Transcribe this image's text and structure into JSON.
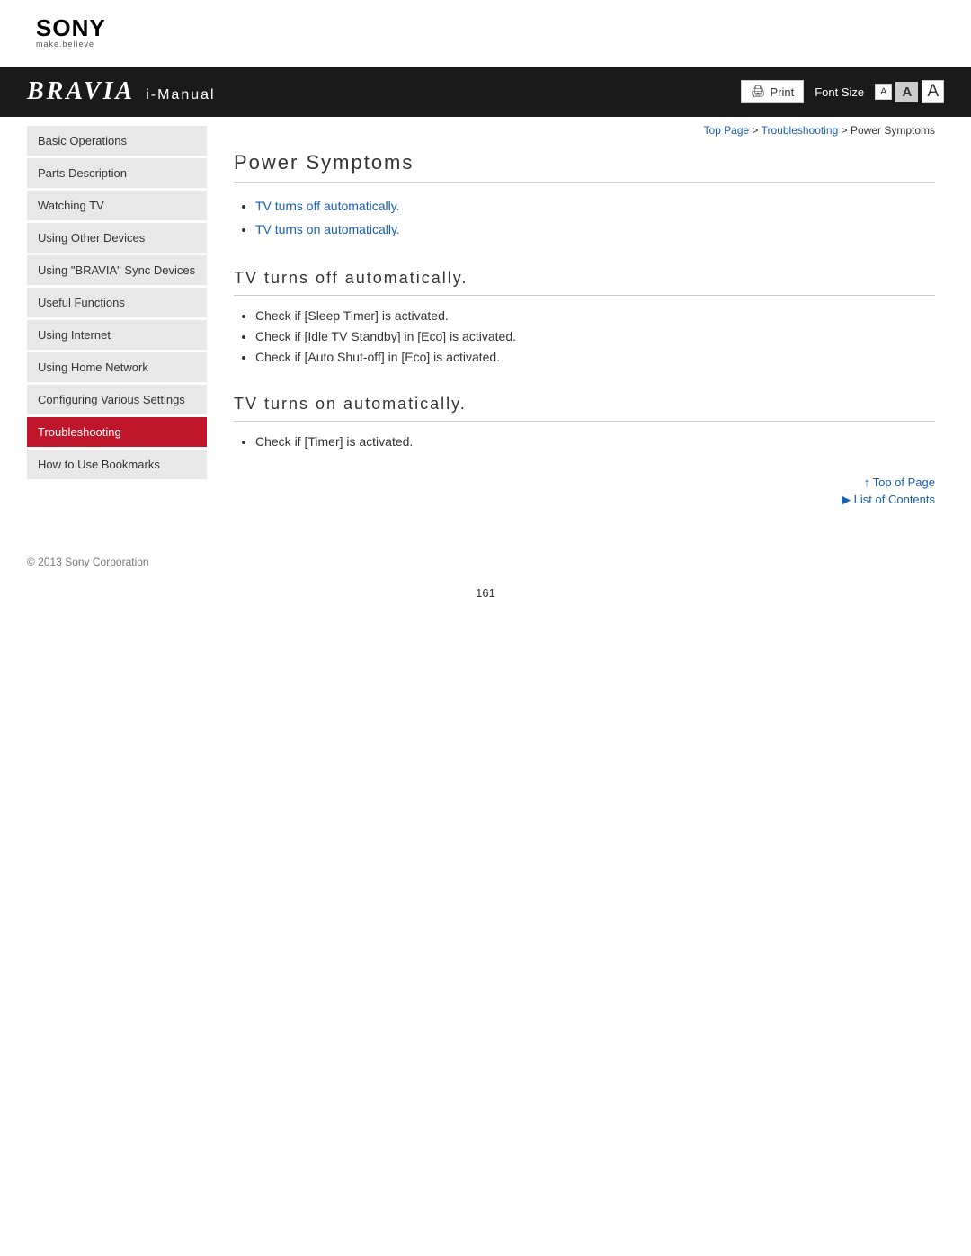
{
  "logo": {
    "brand": "SONY",
    "tagline": "make.believe"
  },
  "header": {
    "bravia": "BRAVIA",
    "imanual": "i-Manual",
    "print_label": "Print",
    "font_size_label": "Font Size",
    "font_small": "A",
    "font_medium": "A",
    "font_large": "A"
  },
  "breadcrumb": {
    "top_page": "Top Page",
    "separator1": " > ",
    "troubleshooting": "Troubleshooting",
    "separator2": " > ",
    "current": "Power Symptoms"
  },
  "sidebar": {
    "items": [
      {
        "id": "basic-operations",
        "label": "Basic Operations",
        "active": false
      },
      {
        "id": "parts-description",
        "label": "Parts Description",
        "active": false
      },
      {
        "id": "watching-tv",
        "label": "Watching TV",
        "active": false
      },
      {
        "id": "using-other-devices",
        "label": "Using Other Devices",
        "active": false
      },
      {
        "id": "using-bravia-sync",
        "label": "Using \"BRAVIA\" Sync Devices",
        "active": false
      },
      {
        "id": "useful-functions",
        "label": "Useful Functions",
        "active": false
      },
      {
        "id": "using-internet",
        "label": "Using Internet",
        "active": false
      },
      {
        "id": "using-home-network",
        "label": "Using Home Network",
        "active": false
      },
      {
        "id": "configuring-settings",
        "label": "Configuring Various Settings",
        "active": false
      },
      {
        "id": "troubleshooting",
        "label": "Troubleshooting",
        "active": true
      },
      {
        "id": "bookmarks",
        "label": "How to Use Bookmarks",
        "active": false
      }
    ]
  },
  "content": {
    "page_title": "Power Symptoms",
    "links": [
      {
        "label": "TV turns off automatically.",
        "href": "#off"
      },
      {
        "label": "TV turns on automatically.",
        "href": "#on"
      }
    ],
    "sections": [
      {
        "id": "off",
        "heading": "TV turns off automatically.",
        "bullets": [
          "Check if [Sleep Timer] is activated.",
          "Check if [Idle TV Standby] in [Eco] is activated.",
          "Check if [Auto Shut-off] in [Eco] is activated."
        ]
      },
      {
        "id": "on",
        "heading": "TV turns on automatically.",
        "bullets": [
          "Check if [Timer] is activated."
        ]
      }
    ],
    "top_of_page": "↑ Top of Page",
    "list_of_contents": "▶ List of Contents"
  },
  "footer": {
    "copyright": "© 2013 Sony Corporation",
    "page_number": "161"
  }
}
